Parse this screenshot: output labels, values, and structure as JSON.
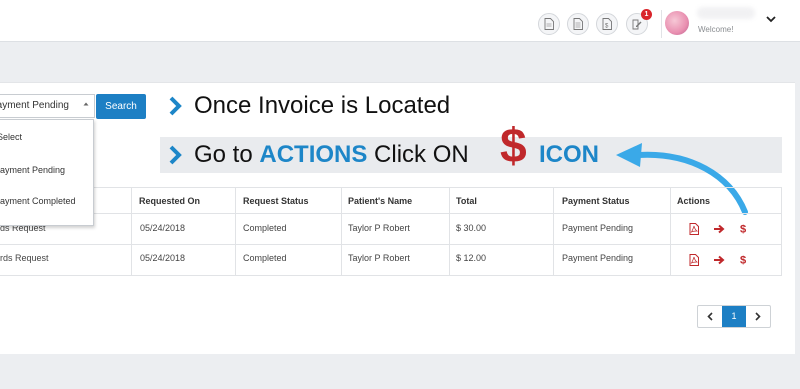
{
  "topbar": {
    "notification_count": "1",
    "welcome_label": "Welcome!"
  },
  "filter": {
    "selected_status": "Payment Pending",
    "search_label": "Search",
    "options": [
      "Select",
      "Payment Pending",
      "Payment Completed"
    ]
  },
  "instructions": {
    "line1": "Once Invoice is Located",
    "line2_prefix": "Go to ",
    "line2_actions": "ACTIONS",
    "line2_mid": " Click ON ",
    "dollar": "$",
    "line2_icon": "ICON"
  },
  "table": {
    "headers": {
      "requested_on": "Requested On",
      "request_status": "Request Status",
      "patient_name": "Patient's Name",
      "total": "Total",
      "payment_status": "Payment Status",
      "actions": "Actions"
    },
    "rows": [
      {
        "type": "ds Request",
        "requested_on": "05/24/2018",
        "status": "Completed",
        "patient": "Taylor P Robert",
        "total": "$ 30.00",
        "payment_status": "Payment Pending"
      },
      {
        "type": "rds Request",
        "requested_on": "05/24/2018",
        "status": "Completed",
        "patient": "Taylor P Robert",
        "total": "$ 12.00",
        "payment_status": "Payment Pending"
      }
    ],
    "action_icons": [
      "pdf-icon",
      "arrow-right-icon",
      "dollar-icon"
    ]
  },
  "pagination": {
    "prev": "‹",
    "current": "1",
    "next": "›"
  },
  "colors": {
    "accent_blue": "#1d7fc4",
    "highlight_blue": "#1d86c8",
    "action_red": "#c0282b"
  }
}
